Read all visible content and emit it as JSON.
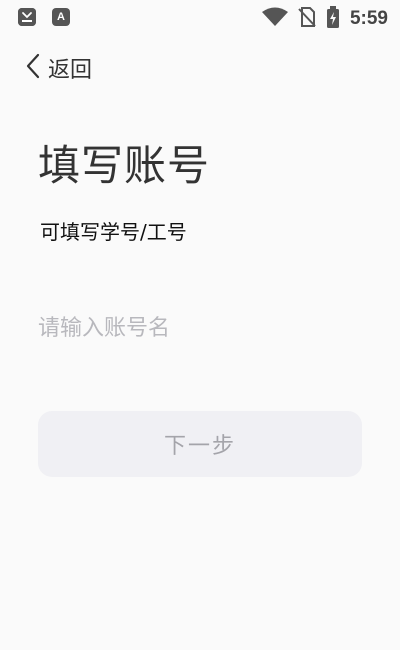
{
  "status_bar": {
    "left_icons": [
      "store-app-icon",
      "a-app-icon"
    ],
    "app2_letter": "A",
    "right_icons": [
      "wifi-icon",
      "no-sim-icon",
      "battery-charging-icon"
    ],
    "time": "5:59"
  },
  "nav": {
    "back_label": "返回"
  },
  "page": {
    "title": "填写账号",
    "subtitle": "可填写学号/工号"
  },
  "form": {
    "account": {
      "value": "",
      "placeholder": "请输入账号名"
    },
    "next_label": "下一步"
  },
  "colors": {
    "background": "#fafafa",
    "button_bg": "#f0f0f4",
    "button_text_disabled": "#a4a4aa",
    "placeholder": "#b8b8bd"
  }
}
